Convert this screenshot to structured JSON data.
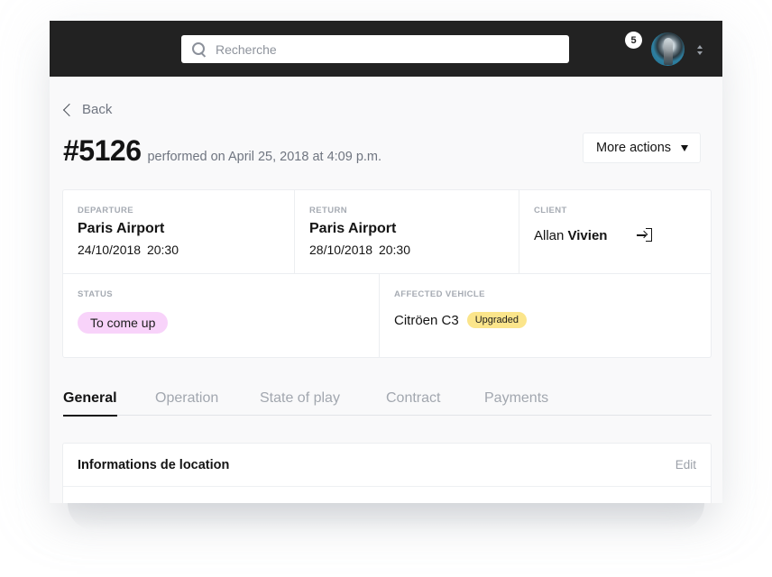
{
  "topbar": {
    "search_placeholder": "Recherche",
    "search_value": "",
    "notification_count": "5",
    "icons": {
      "search": "search-icon",
      "avatar": "user-avatar",
      "account_toggle": "chevron-up-down-icon"
    }
  },
  "nav": {
    "back_label": "Back"
  },
  "order": {
    "number": "#5126",
    "performed_on": "performed on April 25, 2018 at 4:09 p.m.",
    "more_actions_label": "More actions"
  },
  "details": {
    "departure": {
      "label": "Departure",
      "place": "Paris Airport",
      "date": "24/10/2018",
      "time": "20:30"
    },
    "return": {
      "label": "Return",
      "place": "Paris Airport",
      "date": "28/10/2018",
      "time": "20:30"
    },
    "client": {
      "label": "Client",
      "first_name": "Allan",
      "last_name": "Vivien"
    },
    "status": {
      "label": "Status",
      "value": "To come up",
      "color": "#f8d3fa"
    },
    "vehicle": {
      "label": "Affected vehicle",
      "name": "Citröen C3",
      "badge": "Upgraded",
      "badge_color": "#fbe58b"
    }
  },
  "tabs": [
    {
      "label": "General",
      "active": true
    },
    {
      "label": "Operation",
      "active": false
    },
    {
      "label": "State of play",
      "active": false
    },
    {
      "label": "Contract",
      "active": false
    },
    {
      "label": "Payments",
      "active": false
    }
  ],
  "info_section": {
    "title": "Informations de location",
    "edit_label": "Edit"
  },
  "colors": {
    "topbar": "#222222",
    "background": "#f9f9fa",
    "text": "#141414",
    "muted": "#6f7580"
  }
}
